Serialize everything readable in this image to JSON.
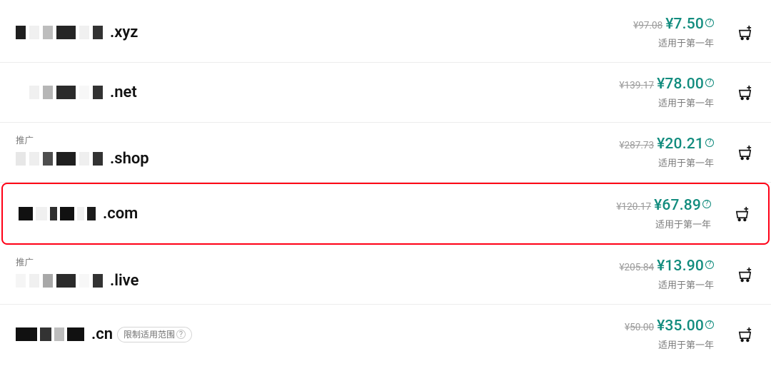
{
  "domains": [
    {
      "tld": ".xyz",
      "promo": null,
      "badge": null,
      "old_price": "¥97.08",
      "price": "¥7.50",
      "note": "适用于第一年",
      "highlight": false,
      "mask": [
        {
          "w": 14,
          "c": "#1f1f1f"
        },
        {
          "w": 14,
          "c": "#f0f0f0"
        },
        {
          "w": 14,
          "c": "#bdbdbd"
        },
        {
          "w": 27,
          "c": "#252525"
        },
        {
          "w": 14,
          "c": "#f0f0f0"
        },
        {
          "w": 14,
          "c": "#333333"
        }
      ]
    },
    {
      "tld": ".net",
      "promo": null,
      "badge": null,
      "old_price": "¥139.17",
      "price": "¥78.00",
      "note": "适用于第一年",
      "highlight": false,
      "mask": [
        {
          "w": 14,
          "c": "#ffffff"
        },
        {
          "w": 14,
          "c": "#f0f0f0"
        },
        {
          "w": 14,
          "c": "#b6b6b6"
        },
        {
          "w": 27,
          "c": "#2b2b2b"
        },
        {
          "w": 14,
          "c": "#f7f7f7"
        },
        {
          "w": 14,
          "c": "#333333"
        }
      ]
    },
    {
      "tld": ".shop",
      "promo": "推广",
      "badge": null,
      "old_price": "¥287.73",
      "price": "¥20.21",
      "note": "适用于第一年",
      "highlight": false,
      "mask": [
        {
          "w": 14,
          "c": "#e7e7e7"
        },
        {
          "w": 14,
          "c": "#eeeeee"
        },
        {
          "w": 14,
          "c": "#4e4e4e"
        },
        {
          "w": 27,
          "c": "#1f1f1f"
        },
        {
          "w": 14,
          "c": "#efefef"
        },
        {
          "w": 14,
          "c": "#333333"
        }
      ]
    },
    {
      "tld": ".com",
      "promo": null,
      "badge": null,
      "old_price": "¥120.17",
      "price": "¥67.89",
      "note": "适用于第一年",
      "highlight": true,
      "mask": [
        {
          "w": 20,
          "c": "#111111"
        },
        {
          "w": 16,
          "c": "#f0f0f0"
        },
        {
          "w": 10,
          "c": "#2e2e2e"
        },
        {
          "w": 20,
          "c": "#111111"
        },
        {
          "w": 10,
          "c": "#f0f0f0"
        },
        {
          "w": 12,
          "c": "#1b1b1b"
        }
      ]
    },
    {
      "tld": ".live",
      "promo": "推广",
      "badge": null,
      "old_price": "¥205.84",
      "price": "¥13.90",
      "note": "适用于第一年",
      "highlight": false,
      "mask": [
        {
          "w": 14,
          "c": "#f5f5f5"
        },
        {
          "w": 14,
          "c": "#f0f0f0"
        },
        {
          "w": 14,
          "c": "#a8a8a8"
        },
        {
          "w": 27,
          "c": "#2b2b2b"
        },
        {
          "w": 14,
          "c": "#f7f7f7"
        },
        {
          "w": 14,
          "c": "#333333"
        }
      ]
    },
    {
      "tld": ".cn",
      "promo": null,
      "badge": "限制适用范围",
      "old_price": "¥50.00",
      "price": "¥35.00",
      "note": "适用于第一年",
      "highlight": false,
      "mask": [
        {
          "w": 30,
          "c": "#111111"
        },
        {
          "w": 16,
          "c": "#333333"
        },
        {
          "w": 14,
          "c": "#bdbdbd"
        },
        {
          "w": 24,
          "c": "#111111"
        }
      ]
    }
  ]
}
